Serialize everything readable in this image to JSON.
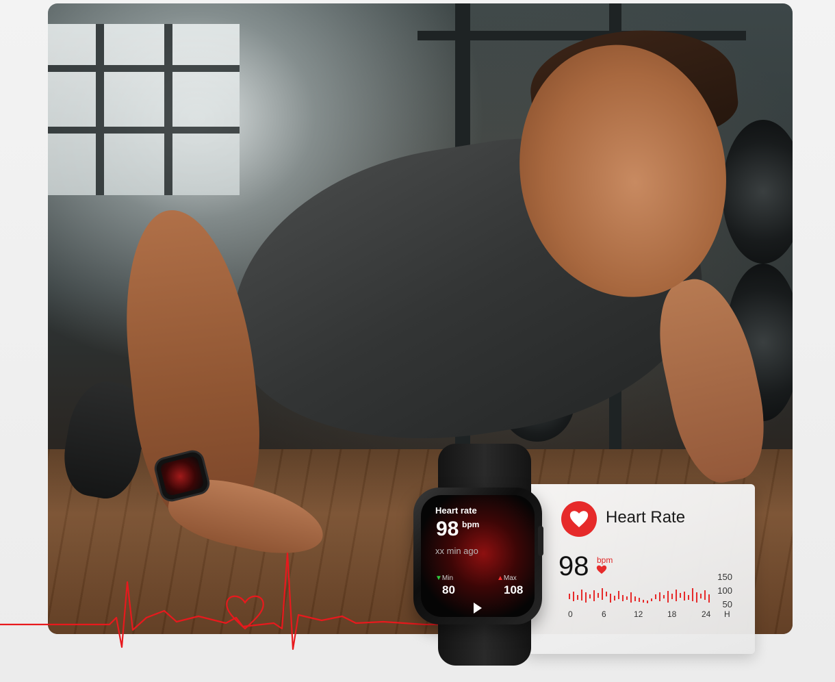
{
  "watch": {
    "title": "Heart rate",
    "value": "98",
    "unit": "bpm",
    "ago": "xx min ago",
    "min_label": "Min",
    "min_value": "80",
    "max_label": "Max",
    "max_value": "108"
  },
  "card": {
    "title": "Heart Rate",
    "value": "98",
    "unit": "bpm",
    "y_ticks": [
      "150",
      "100",
      "50"
    ],
    "x_ticks": [
      "0",
      "6",
      "12",
      "18",
      "24",
      "H"
    ]
  },
  "colors": {
    "accent": "#e62a2a",
    "ecg_line": "#e8191d"
  }
}
